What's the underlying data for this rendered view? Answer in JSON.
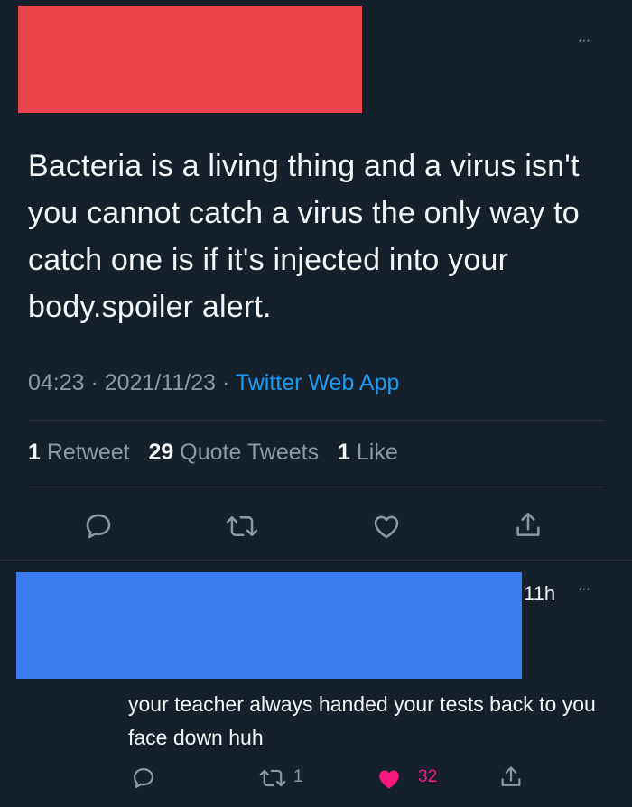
{
  "tweet": {
    "text": "Bacteria is a living thing and a virus isn't you cannot catch a virus the only way to catch one is if it's injected into your body.spoiler alert.",
    "time": "04:23",
    "date": "2021/11/23",
    "source": "Twitter Web App",
    "separator": " · ",
    "stats": {
      "retweets_count": "1",
      "retweets_label": "Retweet",
      "quotes_count": "29",
      "quotes_label": "Quote Tweets",
      "likes_count": "1",
      "likes_label": "Like"
    },
    "more_icon": "⋯"
  },
  "reply": {
    "timestamp": "11h",
    "text": "your teacher always handed your tests back to you face down huh",
    "retweet_count": "1",
    "like_count": "32",
    "more_icon": "⋯"
  },
  "colors": {
    "background": "#15202b",
    "redaction_red": "#ea464c",
    "redaction_blue": "#3b7cf0",
    "link": "#1d9bf0",
    "liked": "#f91880",
    "muted": "#8b98a5"
  }
}
